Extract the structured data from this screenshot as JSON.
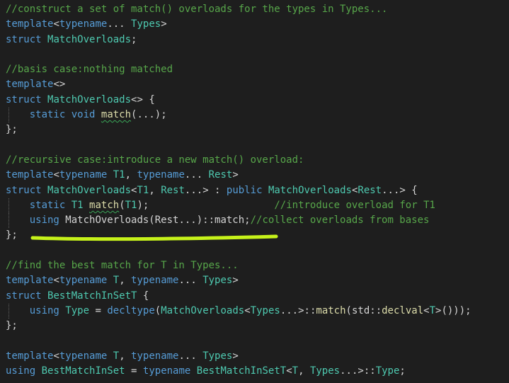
{
  "code": {
    "lines": [
      [
        {
          "t": "//construct a set of match() overloads for the types in Types...",
          "c": "comment"
        }
      ],
      [
        {
          "t": "template",
          "c": "keyword"
        },
        {
          "t": "<",
          "c": "plain"
        },
        {
          "t": "typename",
          "c": "keyword"
        },
        {
          "t": "... ",
          "c": "plain"
        },
        {
          "t": "Types",
          "c": "type"
        },
        {
          "t": ">",
          "c": "plain"
        }
      ],
      [
        {
          "t": "struct",
          "c": "keyword"
        },
        {
          "t": " ",
          "c": "plain"
        },
        {
          "t": "MatchOverloads",
          "c": "type"
        },
        {
          "t": ";",
          "c": "plain"
        }
      ],
      [],
      [
        {
          "t": "//basis case:nothing matched",
          "c": "comment"
        }
      ],
      [
        {
          "t": "template",
          "c": "keyword"
        },
        {
          "t": "<>",
          "c": "plain"
        }
      ],
      [
        {
          "t": "struct",
          "c": "keyword"
        },
        {
          "t": " ",
          "c": "plain"
        },
        {
          "t": "MatchOverloads",
          "c": "type"
        },
        {
          "t": "<> {",
          "c": "plain"
        }
      ],
      [
        {
          "t": "    ",
          "c": "plain"
        },
        {
          "t": "static",
          "c": "keyword"
        },
        {
          "t": " ",
          "c": "plain"
        },
        {
          "t": "void",
          "c": "keyword"
        },
        {
          "t": " ",
          "c": "plain"
        },
        {
          "t": "match",
          "c": "func",
          "squiggle": true
        },
        {
          "t": "(...);",
          "c": "plain"
        }
      ],
      [
        {
          "t": "};",
          "c": "plain"
        }
      ],
      [],
      [
        {
          "t": "//recursive case:introduce a new match() overload:",
          "c": "comment"
        }
      ],
      [
        {
          "t": "template",
          "c": "keyword"
        },
        {
          "t": "<",
          "c": "plain"
        },
        {
          "t": "typename",
          "c": "keyword"
        },
        {
          "t": " ",
          "c": "plain"
        },
        {
          "t": "T1",
          "c": "type"
        },
        {
          "t": ", ",
          "c": "plain"
        },
        {
          "t": "typename",
          "c": "keyword"
        },
        {
          "t": "... ",
          "c": "plain"
        },
        {
          "t": "Rest",
          "c": "type"
        },
        {
          "t": ">",
          "c": "plain"
        }
      ],
      [
        {
          "t": "struct",
          "c": "keyword"
        },
        {
          "t": " ",
          "c": "plain"
        },
        {
          "t": "MatchOverloads",
          "c": "type"
        },
        {
          "t": "<",
          "c": "plain"
        },
        {
          "t": "T1",
          "c": "type"
        },
        {
          "t": ", ",
          "c": "plain"
        },
        {
          "t": "Rest",
          "c": "type"
        },
        {
          "t": "...> : ",
          "c": "plain"
        },
        {
          "t": "public",
          "c": "keyword"
        },
        {
          "t": " ",
          "c": "plain"
        },
        {
          "t": "MatchOverloads",
          "c": "type"
        },
        {
          "t": "<",
          "c": "plain"
        },
        {
          "t": "Rest",
          "c": "type"
        },
        {
          "t": "...> {",
          "c": "plain"
        }
      ],
      [
        {
          "t": "    ",
          "c": "plain"
        },
        {
          "t": "static",
          "c": "keyword"
        },
        {
          "t": " ",
          "c": "plain"
        },
        {
          "t": "T1",
          "c": "type"
        },
        {
          "t": " ",
          "c": "plain"
        },
        {
          "t": "match",
          "c": "func",
          "squiggle": true
        },
        {
          "t": "(",
          "c": "plain"
        },
        {
          "t": "T1",
          "c": "type"
        },
        {
          "t": ");                     ",
          "c": "plain"
        },
        {
          "t": "//introduce overload for T1",
          "c": "comment"
        }
      ],
      [
        {
          "t": "    ",
          "c": "plain"
        },
        {
          "t": "using",
          "c": "keyword"
        },
        {
          "t": " MatchOverloads(Rest...)::match;",
          "c": "plain"
        },
        {
          "t": "//collect overloads from bases",
          "c": "comment"
        }
      ],
      [
        {
          "t": "};",
          "c": "plain"
        }
      ],
      [],
      [
        {
          "t": "//find the best match for T in Types...",
          "c": "comment"
        }
      ],
      [
        {
          "t": "template",
          "c": "keyword"
        },
        {
          "t": "<",
          "c": "plain"
        },
        {
          "t": "typename",
          "c": "keyword"
        },
        {
          "t": " ",
          "c": "plain"
        },
        {
          "t": "T",
          "c": "type"
        },
        {
          "t": ", ",
          "c": "plain"
        },
        {
          "t": "typename",
          "c": "keyword"
        },
        {
          "t": "... ",
          "c": "plain"
        },
        {
          "t": "Types",
          "c": "type"
        },
        {
          "t": ">",
          "c": "plain"
        }
      ],
      [
        {
          "t": "struct",
          "c": "keyword"
        },
        {
          "t": " ",
          "c": "plain"
        },
        {
          "t": "BestMatchInSetT",
          "c": "type"
        },
        {
          "t": " {",
          "c": "plain"
        }
      ],
      [
        {
          "t": "    ",
          "c": "plain"
        },
        {
          "t": "using",
          "c": "keyword"
        },
        {
          "t": " ",
          "c": "plain"
        },
        {
          "t": "Type",
          "c": "type"
        },
        {
          "t": " = ",
          "c": "plain"
        },
        {
          "t": "decltype",
          "c": "keyword"
        },
        {
          "t": "(",
          "c": "plain"
        },
        {
          "t": "MatchOverloads",
          "c": "type"
        },
        {
          "t": "<",
          "c": "plain"
        },
        {
          "t": "Types",
          "c": "type"
        },
        {
          "t": "...>::",
          "c": "plain"
        },
        {
          "t": "match",
          "c": "func"
        },
        {
          "t": "(std::",
          "c": "plain"
        },
        {
          "t": "declval",
          "c": "func"
        },
        {
          "t": "<",
          "c": "plain"
        },
        {
          "t": "T",
          "c": "type"
        },
        {
          "t": ">()));",
          "c": "plain"
        }
      ],
      [
        {
          "t": "};",
          "c": "plain"
        }
      ],
      [],
      [
        {
          "t": "template",
          "c": "keyword"
        },
        {
          "t": "<",
          "c": "plain"
        },
        {
          "t": "typename",
          "c": "keyword"
        },
        {
          "t": " ",
          "c": "plain"
        },
        {
          "t": "T",
          "c": "type"
        },
        {
          "t": ", ",
          "c": "plain"
        },
        {
          "t": "typename",
          "c": "keyword"
        },
        {
          "t": "... ",
          "c": "plain"
        },
        {
          "t": "Types",
          "c": "type"
        },
        {
          "t": ">",
          "c": "plain"
        }
      ],
      [
        {
          "t": "using",
          "c": "keyword"
        },
        {
          "t": " ",
          "c": "plain"
        },
        {
          "t": "BestMatchInSet",
          "c": "type"
        },
        {
          "t": " = ",
          "c": "plain"
        },
        {
          "t": "typename",
          "c": "keyword"
        },
        {
          "t": " ",
          "c": "plain"
        },
        {
          "t": "BestMatchInSetT",
          "c": "type"
        },
        {
          "t": "<",
          "c": "plain"
        },
        {
          "t": "T",
          "c": "type"
        },
        {
          "t": ", ",
          "c": "plain"
        },
        {
          "t": "Types",
          "c": "type"
        },
        {
          "t": "...>::",
          "c": "plain"
        },
        {
          "t": "Type",
          "c": "type"
        },
        {
          "t": ";",
          "c": "plain"
        }
      ]
    ]
  },
  "colors": {
    "background": "#1e1e1e",
    "comment": "#57a64a",
    "keyword": "#569cd6",
    "type": "#4ec9b0",
    "function": "#dcdcaa",
    "plain": "#d4d4d4",
    "highlighter": "#c6f21a"
  }
}
